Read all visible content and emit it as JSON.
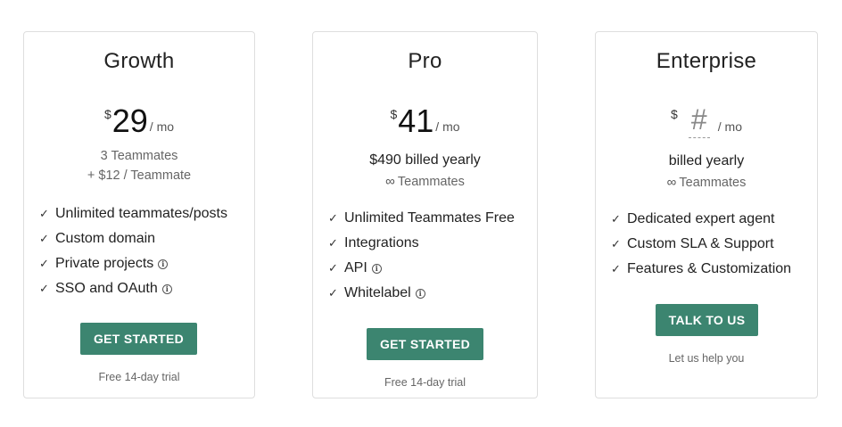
{
  "plans": [
    {
      "name": "Growth",
      "currency": "$",
      "amount": "29",
      "period": "/ mo",
      "line1": "3 Teammates",
      "line2": "+ $12 / Teammate",
      "features": [
        {
          "label": "Unlimited teammates/posts",
          "info": false
        },
        {
          "label": "Custom domain",
          "info": false
        },
        {
          "label": "Private projects",
          "info": true
        },
        {
          "label": "SSO and OAuth",
          "info": true
        }
      ],
      "cta": "GET STARTED",
      "footnote": "Free 14-day trial"
    },
    {
      "name": "Pro",
      "currency": "$",
      "amount": "41",
      "period": "/ mo",
      "line1": "$490 billed yearly",
      "line2_symbol": "∞",
      "line2": "Teammates",
      "features": [
        {
          "label": "Unlimited Teammates Free",
          "info": false
        },
        {
          "label": "Integrations",
          "info": false
        },
        {
          "label": "API",
          "info": true
        },
        {
          "label": "Whitelabel",
          "info": true
        }
      ],
      "cta": "GET STARTED",
      "footnote": "Free 14-day trial"
    },
    {
      "name": "Enterprise",
      "currency": "$",
      "amount": "#",
      "period": "/ mo",
      "line1": "billed yearly",
      "line2_symbol": "∞",
      "line2": "Teammates",
      "features": [
        {
          "label": "Dedicated expert agent",
          "info": false
        },
        {
          "label": "Custom SLA & Support",
          "info": false
        },
        {
          "label": "Features & Customization",
          "info": false
        }
      ],
      "cta": "TALK TO US",
      "footnote": "Let us help you"
    }
  ],
  "icons": {
    "check": "check-icon",
    "info": "info-icon",
    "infinity": "infinity-icon"
  },
  "colors": {
    "accent": "#3c8570",
    "border": "#dedede",
    "muted_text": "#666666"
  }
}
